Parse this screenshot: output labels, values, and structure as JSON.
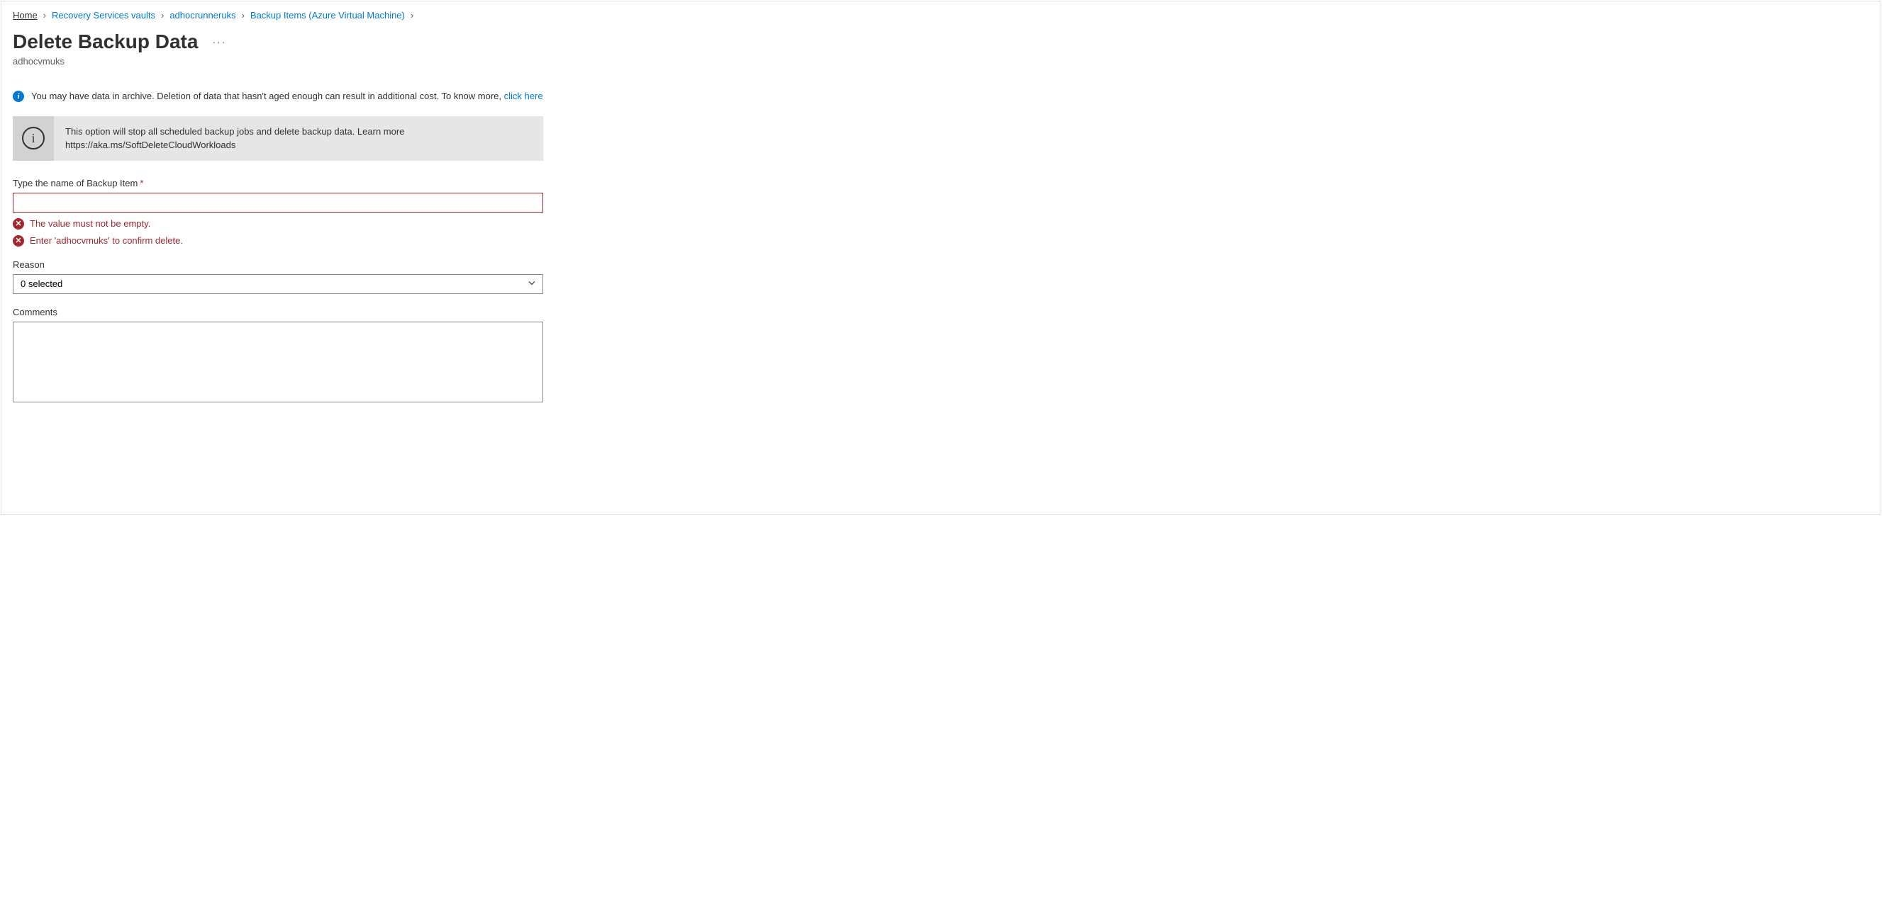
{
  "breadcrumb": {
    "items": [
      {
        "label": "Home"
      },
      {
        "label": "Recovery Services vaults"
      },
      {
        "label": "adhocrunneruks"
      },
      {
        "label": "Backup Items (Azure Virtual Machine)"
      }
    ]
  },
  "header": {
    "title": "Delete Backup Data",
    "subtitle": "adhocvmuks"
  },
  "info_banner": {
    "text_before": "You may have data in archive. Deletion of data that hasn't aged enough can result in additional cost. To know more, ",
    "link": "click here"
  },
  "warning_box": {
    "line1": "This option will stop all scheduled backup jobs and delete backup data. Learn more",
    "line2": "https://aka.ms/SoftDeleteCloudWorkloads"
  },
  "form": {
    "name_field": {
      "label": "Type the name of Backup Item",
      "value": "",
      "errors": [
        "The value must not be empty.",
        "Enter 'adhocvmuks' to confirm delete."
      ]
    },
    "reason_field": {
      "label": "Reason",
      "value": "0 selected"
    },
    "comments_field": {
      "label": "Comments",
      "value": ""
    }
  }
}
